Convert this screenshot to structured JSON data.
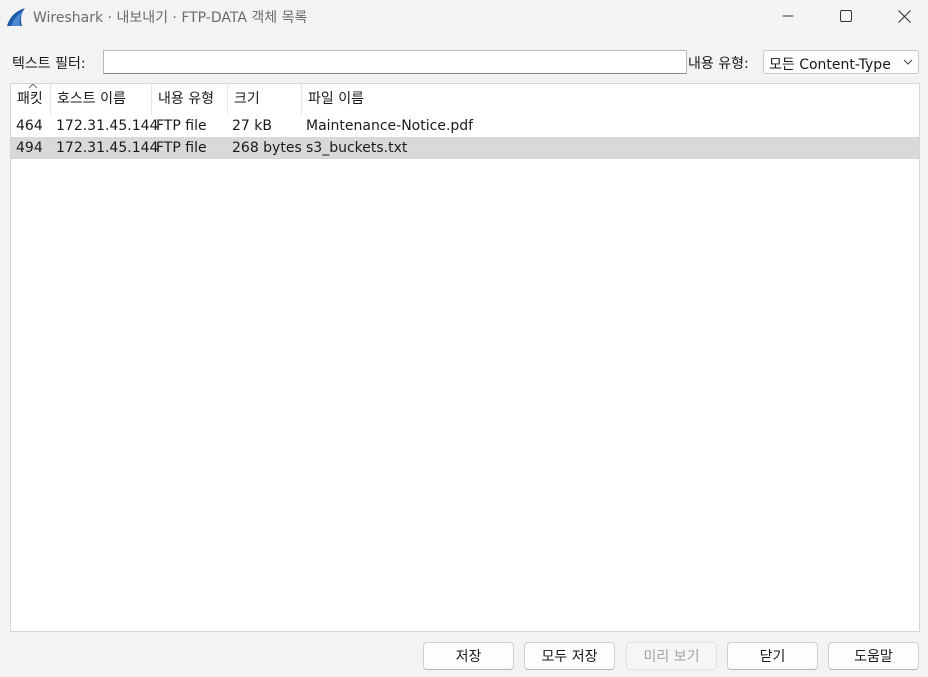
{
  "window": {
    "title": "Wireshark · 내보내기 · FTP-DATA 객체 목록",
    "icon": "wireshark-fin-icon",
    "controls": [
      "minimize-icon",
      "maximize-icon",
      "close-icon"
    ]
  },
  "filter": {
    "text_label": "텍스트 필터:",
    "text_value": "",
    "content_type_label": "내용 유형:",
    "content_type_value": "모든 Content-Type"
  },
  "table": {
    "columns": [
      "패킷",
      "호스트 이름",
      "내용 유형",
      "크기",
      "파일 이름"
    ],
    "rows": [
      {
        "packet": "464",
        "host": "172.31.45.144",
        "type": "FTP file",
        "size": "27 kB",
        "filename": "Maintenance-Notice.pdf",
        "selected": false
      },
      {
        "packet": "494",
        "host": "172.31.45.144",
        "type": "FTP file",
        "size": "268 bytes",
        "filename": "s3_buckets.txt",
        "selected": true
      }
    ]
  },
  "buttons": {
    "save": "저장",
    "save_all": "모두 저장",
    "preview": "미리 보기",
    "close": "닫기",
    "help": "도움말"
  },
  "colors": {
    "accent": "#1f5aa6",
    "selection": "#d9d9d9",
    "background": "#f3f3f3"
  }
}
